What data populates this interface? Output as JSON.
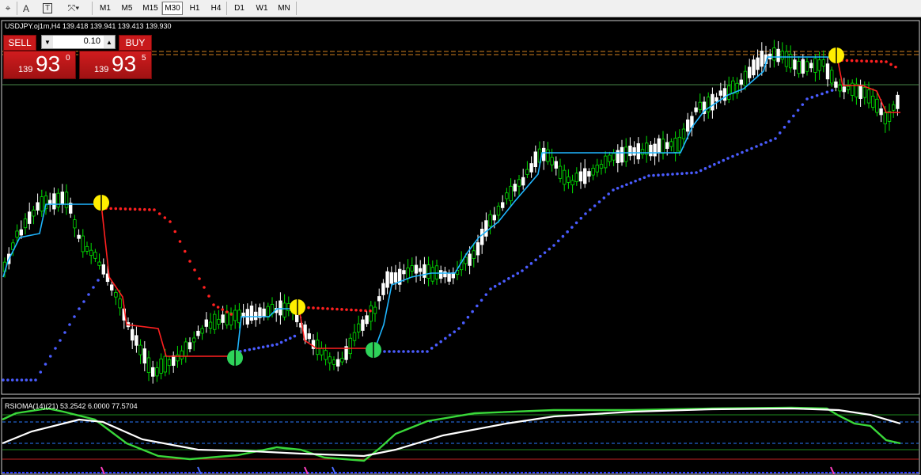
{
  "toolbar": {
    "tools": [
      "cursor-icon",
      "text-icon",
      "text-label-icon",
      "shapes-icon"
    ],
    "timeframes": [
      "M1",
      "M5",
      "M15",
      "M30",
      "H1",
      "H4",
      "D1",
      "W1",
      "MN"
    ],
    "active_timeframe": "M30"
  },
  "chart": {
    "symbol_info": "USDJPY.oj1m,H4  139.418 139.941 139.413 139.930",
    "indicator_label": "RSIOMA(14)(21) 53.2542 6.0000 77.5704",
    "colors": {
      "background": "#000000",
      "bull_candle": "#00e000",
      "bear_candle": "#ffffff",
      "trend_up": "#1fb6ff",
      "trend_down": "#ff2020",
      "stop_dots": "#4a5cff",
      "rsi_line": "#3ad83a",
      "ma_line": "#ffffff"
    }
  },
  "trade": {
    "sell_label": "SELL",
    "buy_label": "BUY",
    "lot": "0.10",
    "sell_price": {
      "prefix": "139",
      "big": "93",
      "sup": "0"
    },
    "buy_price": {
      "prefix": "139",
      "big": "93",
      "sup": "5"
    }
  }
}
